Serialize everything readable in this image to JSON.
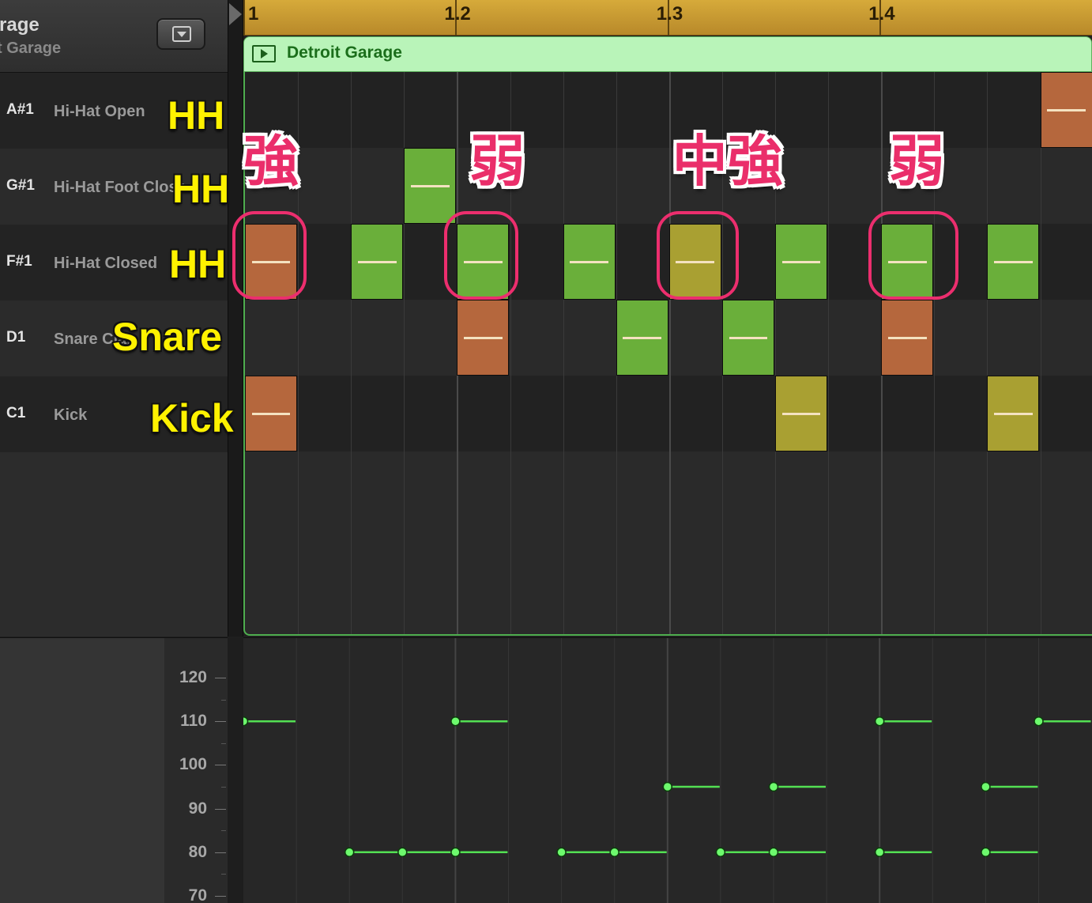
{
  "track": {
    "title": "rage",
    "subtitle": "t Garage"
  },
  "ruler": {
    "labels": [
      {
        "text": "1",
        "beat": 0
      },
      {
        "text": "1.2",
        "beat": 1
      },
      {
        "text": "1.3",
        "beat": 2
      },
      {
        "text": "1.4",
        "beat": 3
      }
    ]
  },
  "region": {
    "name": "Detroit Garage"
  },
  "keys": [
    {
      "note": "A#1",
      "name": "Hi-Hat Open",
      "annotation": "HH"
    },
    {
      "note": "G#1",
      "name": "Hi-Hat Foot Close",
      "annotation": "HH"
    },
    {
      "note": "F#1",
      "name": "Hi-Hat Closed",
      "annotation": "HH"
    },
    {
      "note": "D1",
      "name": "Snare Clap",
      "annotation": "Snare"
    },
    {
      "note": "C1",
      "name": "Kick",
      "annotation": "Kick"
    }
  ],
  "accent_annotations": [
    {
      "text": "強",
      "step": 0
    },
    {
      "text": "弱",
      "step": 4
    },
    {
      "text": "中強",
      "step": 8
    },
    {
      "text": "弱",
      "step": 12
    }
  ],
  "notes": [
    {
      "row": 2,
      "step": 0,
      "velocity": 110
    },
    {
      "row": 4,
      "step": 0,
      "velocity": 110
    },
    {
      "row": 2,
      "step": 2,
      "velocity": 80
    },
    {
      "row": 1,
      "step": 3,
      "velocity": 80
    },
    {
      "row": 2,
      "step": 4,
      "velocity": 80
    },
    {
      "row": 3,
      "step": 4,
      "velocity": 110
    },
    {
      "row": 2,
      "step": 6,
      "velocity": 80
    },
    {
      "row": 3,
      "step": 7,
      "velocity": 80
    },
    {
      "row": 2,
      "step": 8,
      "velocity": 95
    },
    {
      "row": 3,
      "step": 9,
      "velocity": 80
    },
    {
      "row": 2,
      "step": 10,
      "velocity": 80
    },
    {
      "row": 4,
      "step": 10,
      "velocity": 95
    },
    {
      "row": 2,
      "step": 12,
      "velocity": 80
    },
    {
      "row": 3,
      "step": 12,
      "velocity": 110
    },
    {
      "row": 2,
      "step": 14,
      "velocity": 80
    },
    {
      "row": 4,
      "step": 14,
      "velocity": 95
    },
    {
      "row": 0,
      "step": 15,
      "velocity": 110
    }
  ],
  "circled_steps": [
    0,
    4,
    8,
    12
  ],
  "velocity_lane": {
    "labels": [
      120,
      110,
      100,
      90,
      80,
      70
    ],
    "range": [
      70,
      120
    ]
  },
  "colors": {
    "velocity_high": "#b5673d",
    "velocity_mid": "#a9a032",
    "velocity_low": "#6aaf3a",
    "velocity_line": "#53e053",
    "circle": "#ec2e6e",
    "region_fill": "#b9f4b9",
    "ruler_fill": "#c99a30"
  },
  "icons": {
    "menu": "dropdown-menu-icon",
    "region": "play-region-icon",
    "playhead": "playhead-flag-icon"
  }
}
